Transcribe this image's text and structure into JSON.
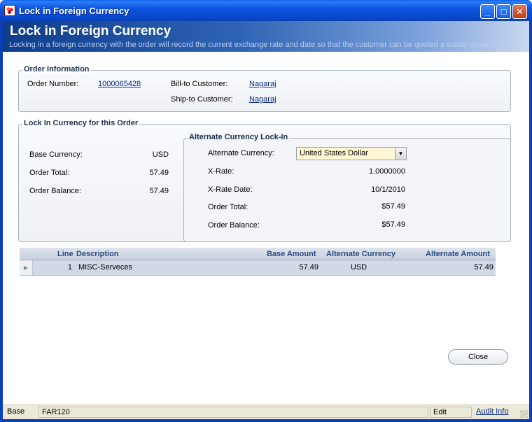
{
  "window": {
    "title": "Lock in Foreign Currency",
    "minimize_glyph": "_",
    "maximize_glyph": "□",
    "close_glyph": "✕"
  },
  "banner": {
    "title": "Lock in Foreign Currency",
    "subtitle": "Locking in a foreign currency with the order will record the current exchange rate and date so that the customer can be quoted a stable amount in"
  },
  "order_info": {
    "title": "Order Information",
    "order_number_label": "Order Number:",
    "order_number": "1000065428",
    "bill_to_label": "Bill-to Customer:",
    "bill_to": "Nagaraj",
    "ship_to_label": "Ship-to Customer:",
    "ship_to": "Nagaraj"
  },
  "lock_in": {
    "title": "Lock In Currency for this Order",
    "base_currency_label": "Base Currency:",
    "base_currency": "USD",
    "order_total_label": "Order Total:",
    "order_total": "57.49",
    "order_balance_label": "Order Balance:",
    "order_balance": "57.49"
  },
  "alternate": {
    "title": "Alternate Currency Lock-In",
    "currency_label": "Alternate Currency:",
    "currency": "United States Dollar",
    "xrate_label": "X-Rate:",
    "xrate": "1.0000000",
    "xrate_date_label": "X-Rate Date:",
    "xrate_date": "10/1/2010",
    "order_total_label": "Order Total:",
    "order_total": "$57.49",
    "order_balance_label": "Order Balance:",
    "order_balance": "$57.49"
  },
  "grid": {
    "columns": [
      "Line",
      "Description",
      "Base Amount",
      "Alternate Currency",
      "Alternate Amount"
    ],
    "rows": [
      {
        "line": "1",
        "description": "MISC-Serveces",
        "base_amount": "57.49",
        "alt_currency": "USD",
        "alt_amount": "57.49"
      }
    ]
  },
  "buttons": {
    "close": "Close"
  },
  "statusbar": {
    "mode": "Base",
    "screen_id": "FAR120",
    "state": "Edit",
    "audit_link": "Audit Info"
  }
}
